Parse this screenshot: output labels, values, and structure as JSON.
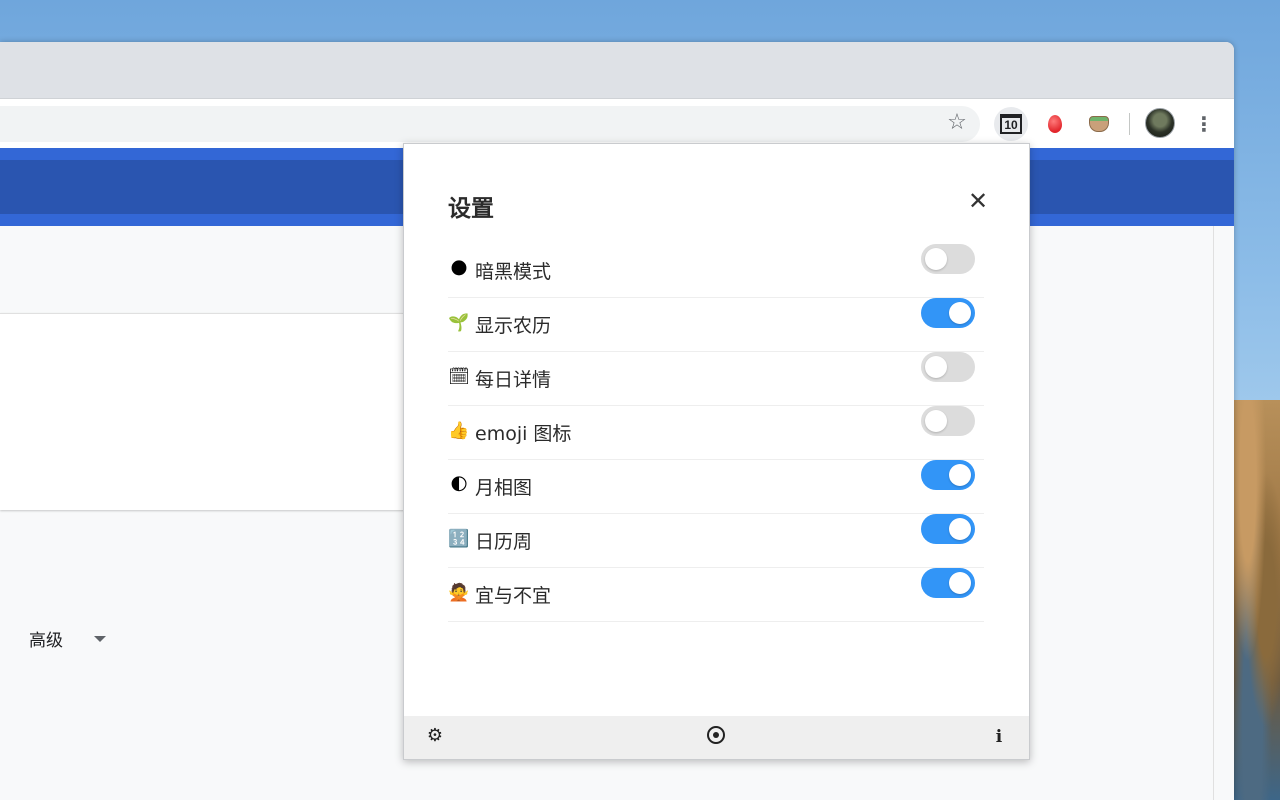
{
  "browser": {
    "bookmark_icon": "star-icon",
    "menu_icon": "three-dots-icon",
    "extensions": [
      {
        "name": "calendar-extension",
        "badge": "10"
      },
      {
        "name": "red-egg-extension"
      },
      {
        "name": "pot-extension"
      }
    ]
  },
  "page": {
    "advanced_label": "高级"
  },
  "popup": {
    "title": "设置",
    "settings": [
      {
        "emoji": "🌑",
        "label": "暗黑模式",
        "enabled": false
      },
      {
        "emoji": "🌱",
        "label": "显示农历",
        "enabled": true
      },
      {
        "emoji": "🗓",
        "label": "每日详情",
        "enabled": false
      },
      {
        "emoji": "👍",
        "label": "emoji 图标",
        "enabled": false
      },
      {
        "emoji": "🌓",
        "label": "月相图",
        "enabled": true
      },
      {
        "emoji": "🔢",
        "label": "日历周",
        "enabled": true
      },
      {
        "emoji": "🙅",
        "label": "宜与不宜",
        "enabled": true
      }
    ],
    "footer": {
      "left_icon": "gear-icon",
      "center_icon": "target-icon",
      "right_icon": "info-icon"
    }
  },
  "colors": {
    "toggle_on": "#3295f7",
    "toggle_off": "#dcdcdc",
    "header_blue": "#3367d6"
  }
}
